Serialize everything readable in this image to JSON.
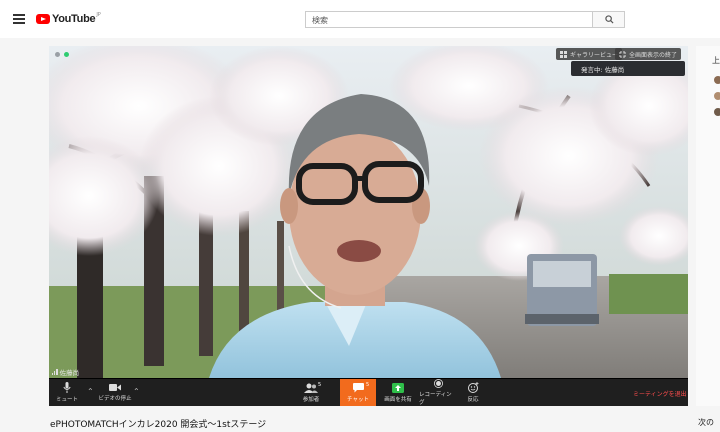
{
  "header": {
    "logo_text": "YouTube",
    "logo_region": "JP",
    "search_placeholder": "検索"
  },
  "player": {
    "topbar": {
      "gallery_view": "ギャラリービュー",
      "exit_fullscreen": "全画面表示の終了"
    },
    "speaker_tooltip": "発言中: 佐藤尚",
    "participant_name": "佐藤尚",
    "controls": {
      "mute": "ミュート",
      "stop_video": "ビデオの停止",
      "participants": "参加者",
      "participants_count": "5",
      "chat": "チャット",
      "chat_count": "5",
      "share_screen": "画面を共有",
      "record": "レコーディング",
      "reactions": "反応",
      "end_meeting": "ミーティングを退出"
    }
  },
  "video": {
    "title": "ePHOTOMATCHインカレ2020 開会式〜1stステージ"
  },
  "sidebar": {
    "up_next_short": "上",
    "next_label": "次の"
  }
}
